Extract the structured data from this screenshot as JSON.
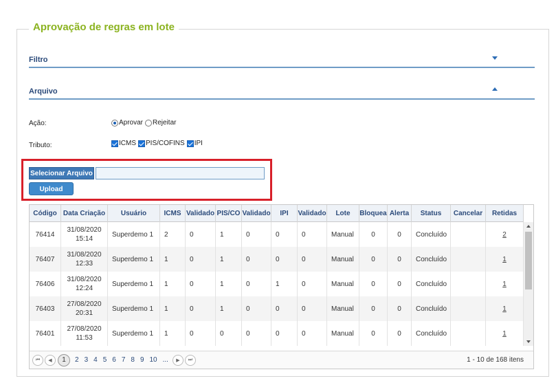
{
  "page": {
    "title": "Aprovação de regras em lote"
  },
  "sections": {
    "filtro": {
      "label": "Filtro"
    },
    "arquivo": {
      "label": "Arquivo"
    }
  },
  "form": {
    "acao": {
      "label": "Ação:",
      "options": [
        {
          "label": "Aprovar",
          "selected": true
        },
        {
          "label": "Rejeitar",
          "selected": false
        }
      ]
    },
    "tributo": {
      "label": "Tributo:",
      "options": [
        {
          "label": "ICMS",
          "checked": true
        },
        {
          "label": "PIS/COFINS",
          "checked": true
        },
        {
          "label": "IPI",
          "checked": true
        }
      ]
    },
    "select_file_label": "Selecionar Arquivo",
    "file_value": "",
    "upload_label": "Upload"
  },
  "table": {
    "columns": [
      "Código",
      "Data Criação",
      "Usuário",
      "ICMS",
      "Validado",
      "PIS/CO",
      "Validado",
      "IPI",
      "Validado",
      "Lote",
      "Bloquea",
      "Alerta",
      "Status",
      "Cancelar",
      "Retidas"
    ],
    "rows": [
      {
        "codigo": "76414",
        "data": "31/08/2020",
        "hora": "15:14",
        "usuario": "Superdemo 1",
        "icms": "2",
        "val1": "0",
        "pis": "1",
        "val2": "0",
        "ipi": "0",
        "val3": "0",
        "lote": "Manual",
        "bloq": "0",
        "alerta": "0",
        "status": "Concluído",
        "cancelar": "",
        "retidas": "2"
      },
      {
        "codigo": "76407",
        "data": "31/08/2020",
        "hora": "12:33",
        "usuario": "Superdemo 1",
        "icms": "1",
        "val1": "0",
        "pis": "1",
        "val2": "0",
        "ipi": "0",
        "val3": "0",
        "lote": "Manual",
        "bloq": "0",
        "alerta": "0",
        "status": "Concluído",
        "cancelar": "",
        "retidas": "1"
      },
      {
        "codigo": "76406",
        "data": "31/08/2020",
        "hora": "12:24",
        "usuario": "Superdemo 1",
        "icms": "1",
        "val1": "0",
        "pis": "1",
        "val2": "0",
        "ipi": "1",
        "val3": "0",
        "lote": "Manual",
        "bloq": "0",
        "alerta": "0",
        "status": "Concluído",
        "cancelar": "",
        "retidas": "1"
      },
      {
        "codigo": "76403",
        "data": "27/08/2020",
        "hora": "20:31",
        "usuario": "Superdemo 1",
        "icms": "1",
        "val1": "0",
        "pis": "1",
        "val2": "0",
        "ipi": "0",
        "val3": "0",
        "lote": "Manual",
        "bloq": "0",
        "alerta": "0",
        "status": "Concluído",
        "cancelar": "",
        "retidas": "1"
      },
      {
        "codigo": "76401",
        "data": "27/08/2020",
        "hora": "11:53",
        "usuario": "Superdemo 1",
        "icms": "1",
        "val1": "0",
        "pis": "0",
        "val2": "0",
        "ipi": "0",
        "val3": "0",
        "lote": "Manual",
        "bloq": "0",
        "alerta": "0",
        "status": "Concluído",
        "cancelar": "",
        "retidas": "1"
      }
    ]
  },
  "pager": {
    "pages": [
      "1",
      "2",
      "3",
      "4",
      "5",
      "6",
      "7",
      "8",
      "9",
      "10",
      "..."
    ],
    "current": "1",
    "info": "1 - 10 de 168 itens"
  },
  "colors": {
    "accent": "#8bb320",
    "primary": "#3f79b6",
    "highlight": "#d8202a"
  }
}
